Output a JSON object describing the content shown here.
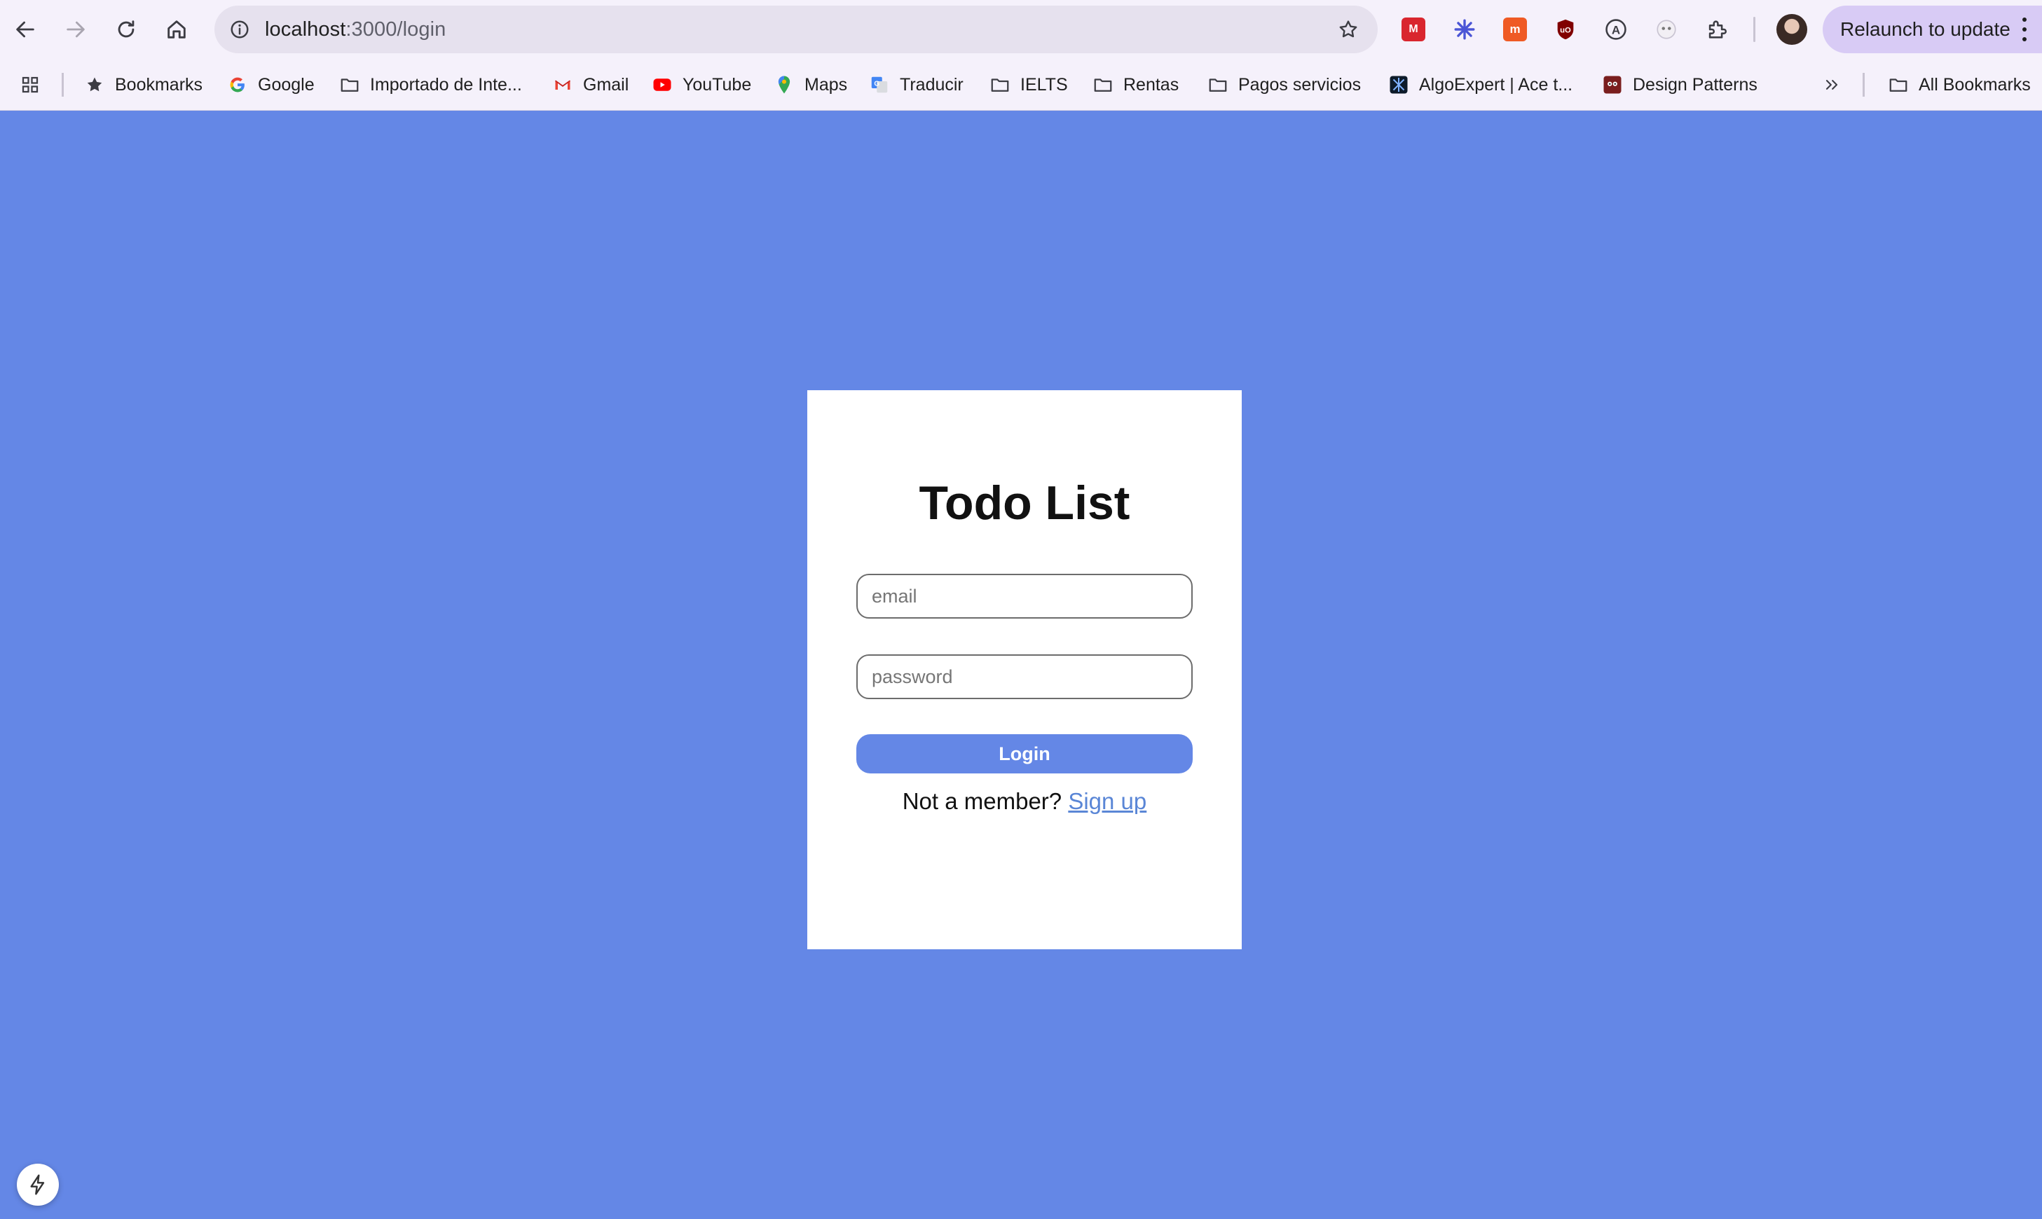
{
  "browser": {
    "url_host": "localhost",
    "url_path": ":3000/login",
    "relaunch_label": "Relaunch to update"
  },
  "bookmarks": [
    {
      "label": "Bookmarks",
      "icon": "star-icon"
    },
    {
      "label": "Google",
      "icon": "google-icon"
    },
    {
      "label": "Importado de Inte...",
      "icon": "folder-icon"
    },
    {
      "label": "Gmail",
      "icon": "gmail-icon"
    },
    {
      "label": "YouTube",
      "icon": "youtube-icon"
    },
    {
      "label": "Maps",
      "icon": "maps-icon"
    },
    {
      "label": "Traducir",
      "icon": "translate-icon"
    },
    {
      "label": "IELTS",
      "icon": "folder-icon"
    },
    {
      "label": "Rentas",
      "icon": "folder-icon"
    },
    {
      "label": "Pagos servicios",
      "icon": "folder-icon"
    },
    {
      "label": "AlgoExpert | Ace t...",
      "icon": "algoexpert-icon"
    },
    {
      "label": "Design Patterns",
      "icon": "refactoring-icon"
    }
  ],
  "all_bookmarks_label": "All Bookmarks",
  "login": {
    "title": "Todo List",
    "email_placeholder": "email",
    "password_placeholder": "password",
    "login_button": "Login",
    "not_member_text": "Not a member?",
    "signup_link": "Sign up"
  },
  "colors": {
    "page_background": "#6487e6",
    "accent": "#6487e6",
    "link": "#5a86d6"
  }
}
